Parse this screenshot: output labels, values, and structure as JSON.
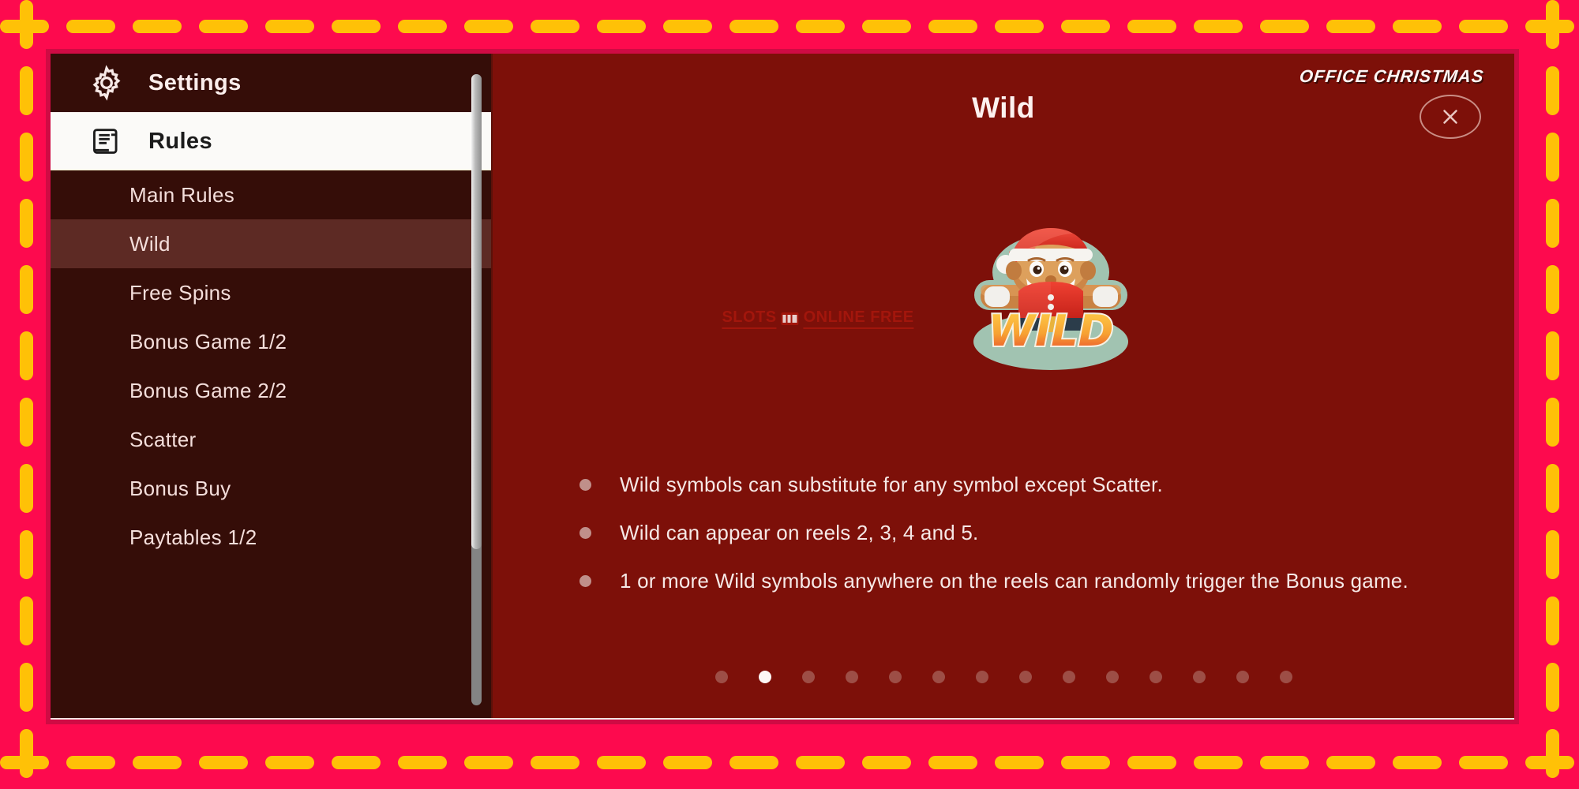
{
  "frame": {
    "bg_color": "#fd0a4e",
    "dash_color": "#ffc107",
    "modal_border_color": "#cf0b44"
  },
  "sidebar": {
    "headings": [
      {
        "label": "Settings",
        "icon": "gear-icon",
        "active": false
      },
      {
        "label": "Rules",
        "icon": "scroll-icon",
        "active": true
      }
    ],
    "items": [
      {
        "label": "Main Rules",
        "active": false
      },
      {
        "label": "Wild",
        "active": true
      },
      {
        "label": "Free Spins",
        "active": false
      },
      {
        "label": "Bonus Game 1/2",
        "active": false
      },
      {
        "label": "Bonus Game 2/2",
        "active": false
      },
      {
        "label": "Scatter",
        "active": false
      },
      {
        "label": "Bonus Buy",
        "active": false
      },
      {
        "label": "Paytables 1/2",
        "active": false
      }
    ],
    "scrollbar": {
      "name": "sidebar-scrollbar"
    }
  },
  "content": {
    "brand": "OFFICE CHRISTMAS",
    "title": "Wild",
    "close_icon": "close-icon",
    "symbol": {
      "name": "wild-symbol-gingerbread-santa",
      "caption": "WILD"
    },
    "watermark": {
      "left": "SLOTS",
      "right": "ONLINE FREE",
      "icon": "slot-machine-icon"
    },
    "bullets": [
      "Wild symbols can substitute for any symbol except Scatter.",
      "Wild can appear on reels 2, 3, 4 and 5.",
      "1 or more Wild symbols anywhere on the reels can randomly trigger the Bonus game."
    ],
    "pagination": {
      "total": 14,
      "active_index": 1
    }
  }
}
